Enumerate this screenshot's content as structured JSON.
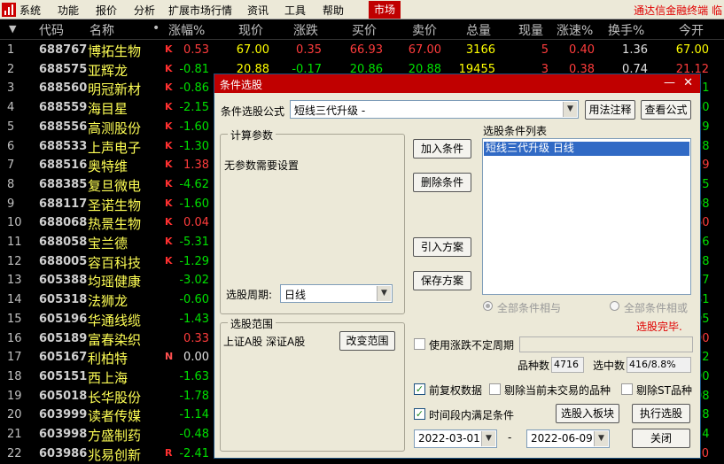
{
  "menubar": {
    "items": [
      "系统",
      "功能",
      "报价",
      "分析",
      "扩展市场行情",
      "资讯",
      "工具",
      "帮助"
    ],
    "market_tab": "市场",
    "brand": "通达信金融终端 临"
  },
  "table": {
    "headers": [
      "代码",
      "名称",
      "•",
      "涨幅%",
      "现价",
      "涨跌",
      "买价",
      "卖价",
      "总量",
      "现量",
      "涨速%",
      "换手%",
      "今开"
    ],
    "rows": [
      {
        "idx": "1",
        "code": "688767",
        "name": "博拓生物",
        "flag": "K",
        "pct": "0.53",
        "dir": "up",
        "price": "67.00",
        "chg": "0.35",
        "bid": "66.93",
        "ask": "67.00",
        "vol": "3166",
        "cur": "5",
        "spd": "0.40",
        "turn": "1.36",
        "open": "67.00"
      },
      {
        "idx": "2",
        "code": "688575",
        "name": "亚辉龙",
        "flag": "K",
        "pct": "-0.81",
        "dir": "dn",
        "price": "20.88",
        "chg": "-0.17",
        "bid": "20.86",
        "ask": "20.88",
        "vol": "19455",
        "cur": "3",
        "spd": "0.38",
        "turn": "0.74",
        "open": "21.12"
      },
      {
        "idx": "3",
        "code": "688560",
        "name": "明冠新材",
        "flag": "K",
        "pct": "-0.86",
        "dir": "dn",
        "open": "21"
      },
      {
        "idx": "4",
        "code": "688559",
        "name": "海目星",
        "flag": "K",
        "pct": "-2.15",
        "dir": "dn",
        "open": "30"
      },
      {
        "idx": "5",
        "code": "688556",
        "name": "高测股份",
        "flag": "K",
        "pct": "-1.60",
        "dir": "dn",
        "open": "19"
      },
      {
        "idx": "6",
        "code": "688533",
        "name": "上声电子",
        "flag": "K",
        "pct": "-1.30",
        "dir": "dn",
        "open": "28"
      },
      {
        "idx": "7",
        "code": "688516",
        "name": "奥特维",
        "flag": "K",
        "pct": "1.38",
        "dir": "up",
        "open": "59"
      },
      {
        "idx": "8",
        "code": "688385",
        "name": "复旦微电",
        "flag": "K",
        "pct": "-4.62",
        "dir": "dn",
        "open": "35"
      },
      {
        "idx": "9",
        "code": "688117",
        "name": "圣诺生物",
        "flag": "K",
        "pct": "-1.60",
        "dir": "dn",
        "open": "98"
      },
      {
        "idx": "10",
        "code": "688068",
        "name": "热景生物",
        "flag": "K",
        "pct": "0.04",
        "dir": "up",
        "open": "60"
      },
      {
        "idx": "11",
        "code": "688058",
        "name": "宝兰德",
        "flag": "K",
        "pct": "-5.31",
        "dir": "dn",
        "open": "56"
      },
      {
        "idx": "12",
        "code": "688005",
        "name": "容百科技",
        "flag": "K",
        "pct": "-1.29",
        "dir": "dn",
        "open": "28"
      },
      {
        "idx": "13",
        "code": "605388",
        "name": "均瑶健康",
        "flag": "",
        "pct": "-3.02",
        "dir": "dn",
        "open": "77"
      },
      {
        "idx": "14",
        "code": "605318",
        "name": "法狮龙",
        "flag": "",
        "pct": "-0.60",
        "dir": "dn",
        "open": "81"
      },
      {
        "idx": "15",
        "code": "605196",
        "name": "华通线缆",
        "flag": "",
        "pct": "-1.43",
        "dir": "dn",
        "open": "95"
      },
      {
        "idx": "16",
        "code": "605189",
        "name": "富春染织",
        "flag": "",
        "pct": "0.33",
        "dir": "up",
        "open": "90"
      },
      {
        "idx": "17",
        "code": "605167",
        "name": "利柏特",
        "flag": "N",
        "pct": "0.00",
        "dir": "flat",
        "open": "72"
      },
      {
        "idx": "18",
        "code": "605151",
        "name": "西上海",
        "flag": "",
        "pct": "-1.63",
        "dir": "dn",
        "open": "90"
      },
      {
        "idx": "19",
        "code": "605018",
        "name": "长华股份",
        "flag": "",
        "pct": "-1.78",
        "dir": "dn",
        "open": "08"
      },
      {
        "idx": "20",
        "code": "603999",
        "name": "读者传媒",
        "flag": "",
        "pct": "-1.14",
        "dir": "dn",
        "open": "18"
      },
      {
        "idx": "21",
        "code": "603998",
        "name": "方盛制药",
        "flag": "",
        "pct": "-0.48",
        "dir": "dn",
        "open": "24"
      },
      {
        "idx": "22",
        "code": "603986",
        "name": "兆易创新",
        "flag": "R",
        "pct": "-2.41",
        "dir": "dn",
        "price": "139.15",
        "chg": "-3.43",
        "bid": "139.15",
        "ask": "139.15",
        "vol": "31015",
        "cur": "7",
        "spd": "0.17",
        "turn": "0.50",
        "open": "141.50"
      }
    ]
  },
  "dialog": {
    "title": "条件选股",
    "formula_label": "条件选股公式",
    "formula_value": "短线三代升级 -",
    "usage_button": "用法注释",
    "view_button": "查看公式",
    "params_group": "计算参数",
    "params_text": "无参数需要设置",
    "add_button": "加入条件",
    "delete_button": "删除条件",
    "import_button": "引入方案",
    "save_button": "保存方案",
    "list_label": "选股条件列表",
    "conditions": [
      "短线三代升级  日线"
    ],
    "period_label": "选股周期:",
    "period_value": "日线",
    "all_and": "全部条件相与",
    "all_or": "全部条件相或",
    "status": "选股完毕.",
    "scope_group": "选股范围",
    "scope_text": "上证A股 深证A股",
    "change_scope_button": "改变范围",
    "uncertain_period_label": "使用涨跌不定周期",
    "count_label": "品种数",
    "count_value": "4716",
    "selected_label": "选中数",
    "selected_value": "416/8.8%",
    "pre_adjust_label": "前复权数据",
    "exclude_untraded_label": "剔除当前未交易的品种",
    "exclude_st_label": "剔除ST品种",
    "time_range_label": "时间段内满足条件",
    "to_block_button": "选股入板块",
    "run_button": "执行选股",
    "start_date": "2022-03-01",
    "dash": "-",
    "end_date": "2022-06-09",
    "close_button": "关闭",
    "check_mark": "✓"
  },
  "colors": {
    "up": "#ff3c3c",
    "down": "#00e000",
    "title_bar": "#c00000"
  }
}
